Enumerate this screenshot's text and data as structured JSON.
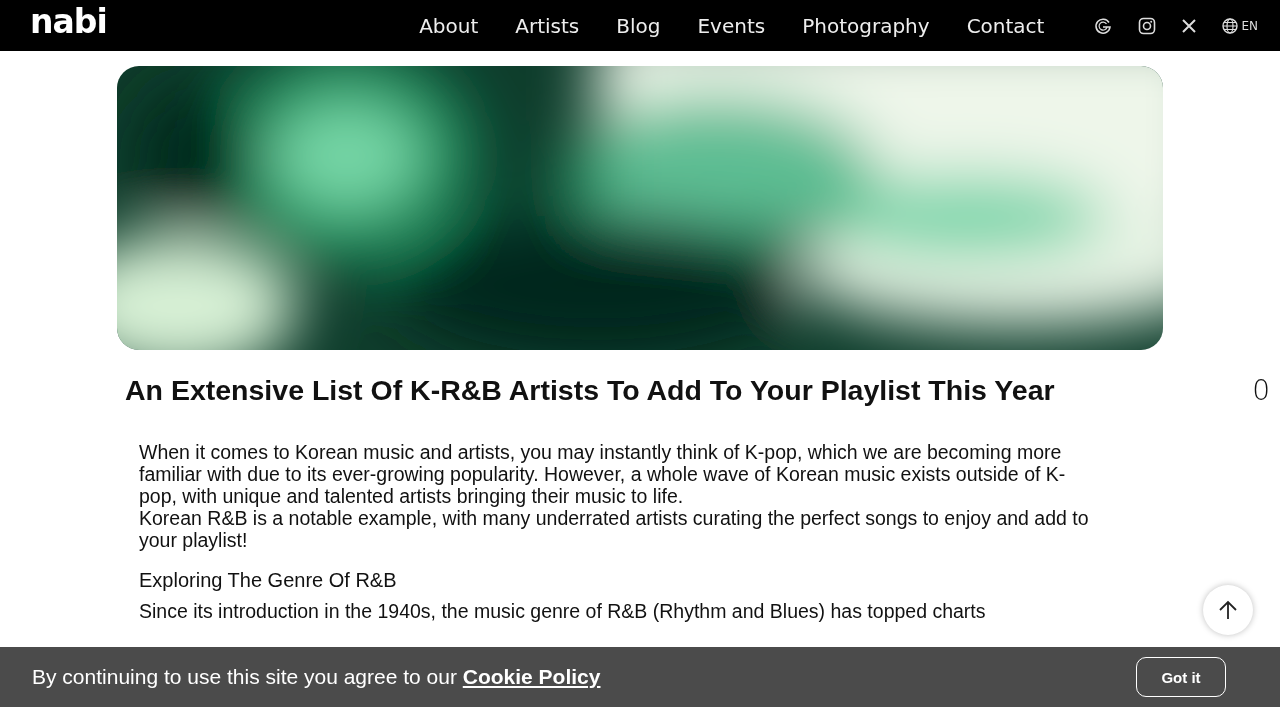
{
  "header": {
    "logo": "nabi",
    "nav": [
      {
        "label": "About"
      },
      {
        "label": "Artists"
      },
      {
        "label": "Blog"
      },
      {
        "label": "Events"
      },
      {
        "label": "Photography"
      },
      {
        "label": "Contact"
      }
    ],
    "language": "EN"
  },
  "article": {
    "title": "An Extensive List Of  K-R&B Artists To Add To Your Playlist This Year",
    "side_count": "0",
    "paragraphs": [
      "When it comes to Korean music and artists, you may instantly think of K-pop, which we are becoming more familiar with due to its ever-growing popularity. However, a whole wave of Korean music exists outside of K-pop, with unique and talented artists bringing their music to life.",
      "Korean R&B is a notable example, with many underrated artists curating the perfect songs to enjoy and add to your playlist!"
    ],
    "heading": "Exploring The Genre Of R&B",
    "paragraph_2": "Since its introduction in the 1940s, the music genre of R&B (Rhythm and Blues) has topped charts"
  },
  "cookie_banner": {
    "text": "By continuing to use this site you agree to our ",
    "link": "Cookie Policy",
    "button": "Got it"
  }
}
